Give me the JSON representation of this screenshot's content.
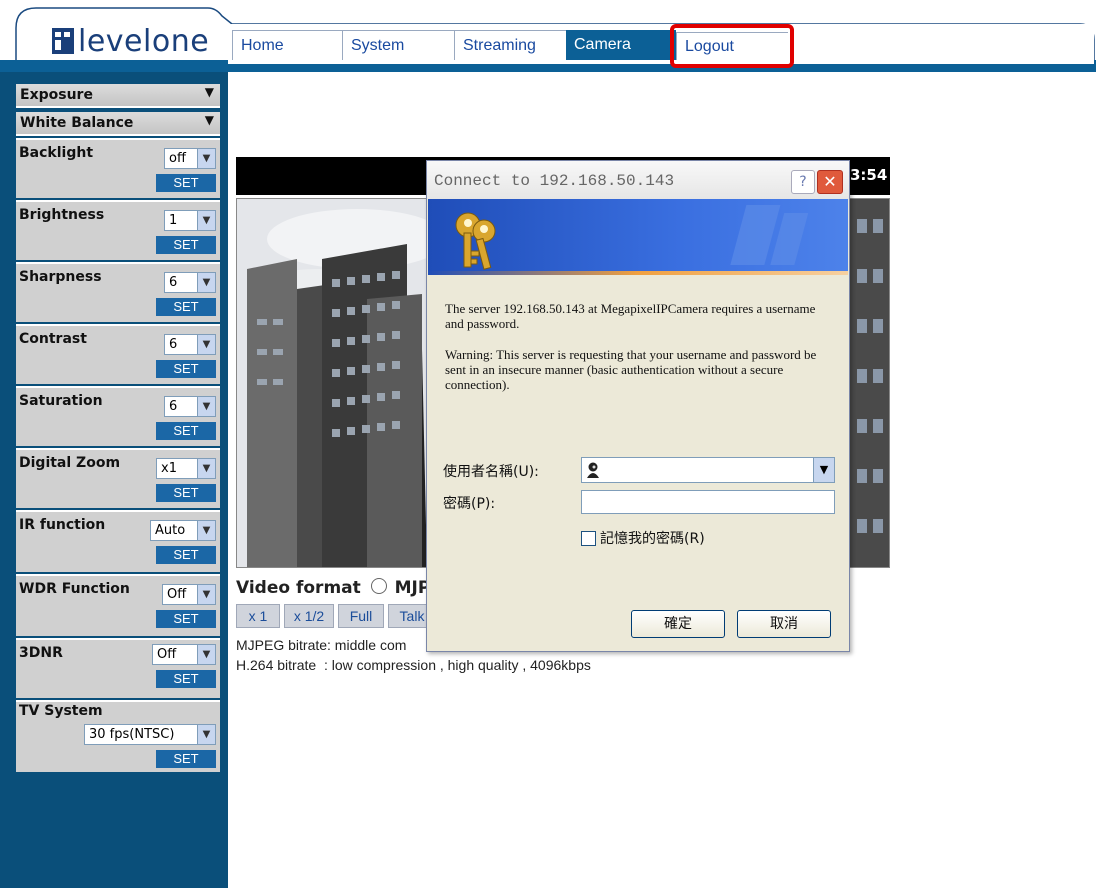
{
  "header": {
    "logo_text": "levelone",
    "tabs": [
      {
        "label": "Home",
        "active": false
      },
      {
        "label": "System",
        "active": false
      },
      {
        "label": "Streaming",
        "active": false
      },
      {
        "label": "Camera",
        "active": true
      },
      {
        "label": "Logout",
        "active": false,
        "highlighted": true
      }
    ],
    "highlight_color": "#e00000"
  },
  "sidebar": {
    "collapsed": [
      {
        "label": "Exposure",
        "icon": "triangle-down-icon"
      },
      {
        "label": "White Balance",
        "icon": "triangle-down-icon"
      }
    ],
    "settings": [
      {
        "label": "Backlight",
        "value": "off",
        "button": "SET"
      },
      {
        "label": "Brightness",
        "value": "1",
        "button": "SET"
      },
      {
        "label": "Sharpness",
        "value": "6",
        "button": "SET"
      },
      {
        "label": "Contrast",
        "value": "6",
        "button": "SET"
      },
      {
        "label": "Saturation",
        "value": "6",
        "button": "SET"
      },
      {
        "label": "Digital Zoom",
        "value": "x1",
        "button": "SET"
      },
      {
        "label": "IR function",
        "value": "Auto",
        "button": "SET"
      },
      {
        "label": "WDR Function",
        "value": "Off",
        "button": "SET"
      },
      {
        "label": "3DNR",
        "value": "Off",
        "button": "SET"
      },
      {
        "label": "TV System",
        "value": "30 fps(NTSC)",
        "button": "SET"
      }
    ]
  },
  "video": {
    "time_fragment": "3:54",
    "format_label": "Video format",
    "format_option": "MJP",
    "buttons": [
      "x 1",
      "x 1/2",
      "Full",
      "Talk"
    ],
    "mjpeg_bitrate": "MJPEG bitrate: middle com",
    "h264_bitrate": "H.264 bitrate  : low compression , high quality , 4096kbps"
  },
  "dialog": {
    "title": "Connect to 192.168.50.143",
    "help": "?",
    "close": "✕",
    "message1": "The server 192.168.50.143 at MegapixelIPCamera requires a username and password.",
    "message2": "Warning: This server is requesting that your username and password be sent in an insecure manner (basic authentication without a secure connection).",
    "username_label": "使用者名稱(U):",
    "password_label": "密碼(P):",
    "remember_label": "記憶我的密碼(R)",
    "ok": "確定",
    "cancel": "取消",
    "icon": "keys-icon"
  },
  "colors": {
    "nav_blue": "#0c6096",
    "sidebar_bg": "#0a4f7a",
    "set_button": "#1b67a6"
  }
}
